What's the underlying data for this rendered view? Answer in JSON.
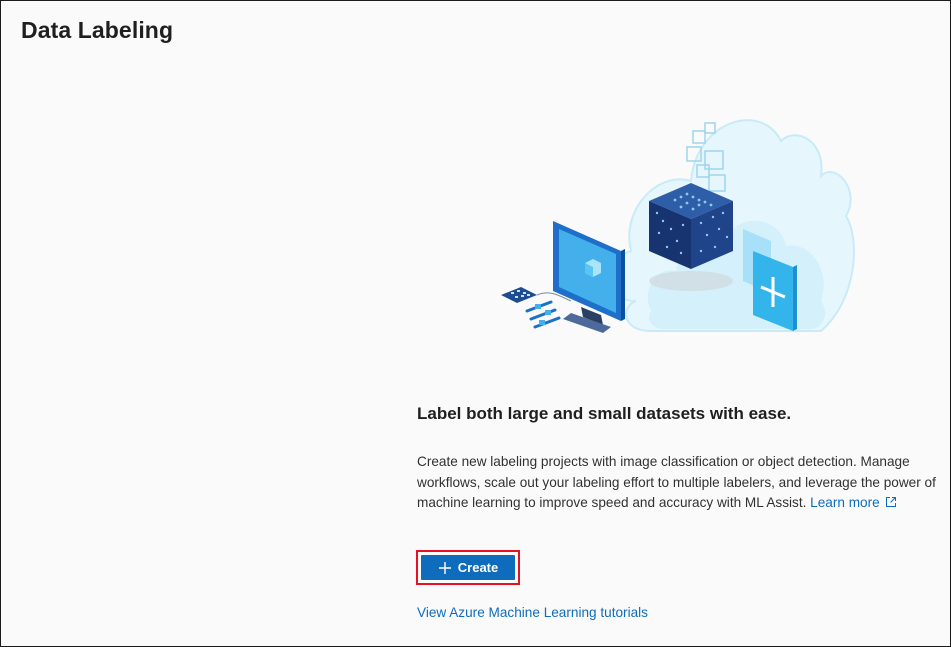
{
  "header": {
    "title": "Data Labeling"
  },
  "hero": {
    "illustration": "cloud-data-labeling-illustration"
  },
  "main": {
    "heading": "Label both large and small datasets with ease.",
    "description": "Create new labeling projects with image classification or object detection. Manage workflows, scale out your labeling effort to multiple labelers, and leverage the power of machine learning to improve speed and accuracy with ML Assist.",
    "learn_more": "Learn more",
    "create_label": "Create",
    "tutorials_link": "View Azure Machine Learning tutorials"
  },
  "colors": {
    "accent": "#0f6cbd",
    "highlight": "#e81123",
    "cube": "#1b3d7a"
  }
}
